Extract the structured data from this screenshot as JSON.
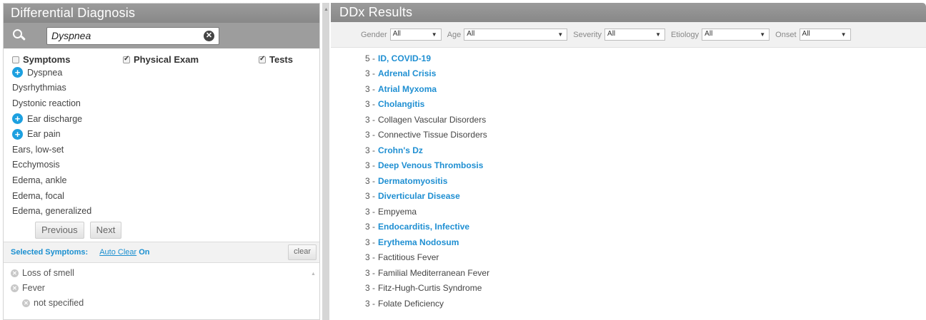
{
  "left_panel": {
    "title": "Differential Diagnosis",
    "search": {
      "value": "Dyspnea"
    },
    "filters": [
      {
        "label": "Symptoms",
        "checked": false
      },
      {
        "label": "Physical Exam",
        "checked": true
      },
      {
        "label": "Tests",
        "checked": true
      }
    ],
    "items": [
      {
        "label": "Dyspnea",
        "has_plus": true
      },
      {
        "label": "Dysrhythmias",
        "has_plus": false
      },
      {
        "label": "Dystonic reaction",
        "has_plus": false
      },
      {
        "label": "Ear discharge",
        "has_plus": true
      },
      {
        "label": "Ear pain",
        "has_plus": true
      },
      {
        "label": "Ears, low-set",
        "has_plus": false
      },
      {
        "label": "Ecchymosis",
        "has_plus": false
      },
      {
        "label": "Edema, ankle",
        "has_plus": false
      },
      {
        "label": "Edema, focal",
        "has_plus": false
      },
      {
        "label": "Edema, generalized",
        "has_plus": false
      }
    ],
    "pager": {
      "previous": "Previous",
      "next": "Next"
    },
    "selected": {
      "title": "Selected Symptoms:",
      "auto_clear_label": "Auto Clear",
      "auto_clear_state": "On",
      "clear_label": "clear",
      "items": [
        {
          "label": "Loss of smell",
          "sub": false
        },
        {
          "label": "Fever",
          "sub": false
        },
        {
          "label": "not specified",
          "sub": true
        }
      ]
    }
  },
  "right_panel": {
    "title": "DDx Results",
    "filters": [
      {
        "label": "Gender",
        "value": "All"
      },
      {
        "label": "Age",
        "value": "All"
      },
      {
        "label": "Severity",
        "value": "All"
      },
      {
        "label": "Etiology",
        "value": "All"
      },
      {
        "label": "Onset",
        "value": "All"
      }
    ],
    "results": [
      {
        "score": "5 -",
        "name": "ID, COVID-19",
        "link": true
      },
      {
        "score": "3 -",
        "name": "Adrenal Crisis",
        "link": true
      },
      {
        "score": "3 -",
        "name": "Atrial Myxoma",
        "link": true
      },
      {
        "score": "3 -",
        "name": "Cholangitis",
        "link": true
      },
      {
        "score": "3 -",
        "name": "Collagen Vascular Disorders",
        "link": false
      },
      {
        "score": "3 -",
        "name": "Connective Tissue Disorders",
        "link": false
      },
      {
        "score": "3 -",
        "name": "Crohn's Dz",
        "link": true
      },
      {
        "score": "3 -",
        "name": "Deep Venous Thrombosis",
        "link": true
      },
      {
        "score": "3 -",
        "name": "Dermatomyositis",
        "link": true
      },
      {
        "score": "3 -",
        "name": "Diverticular Disease",
        "link": true
      },
      {
        "score": "3 -",
        "name": "Empyema",
        "link": false
      },
      {
        "score": "3 -",
        "name": "Endocarditis, Infective",
        "link": true
      },
      {
        "score": "3 -",
        "name": "Erythema Nodosum",
        "link": true
      },
      {
        "score": "3 -",
        "name": "Factitious Fever",
        "link": false
      },
      {
        "score": "3 -",
        "name": "Familial Mediterranean Fever",
        "link": false
      },
      {
        "score": "3 -",
        "name": "Fitz-Hugh-Curtis Syndrome",
        "link": false
      },
      {
        "score": "3 -",
        "name": "Folate Deficiency",
        "link": false
      }
    ]
  }
}
